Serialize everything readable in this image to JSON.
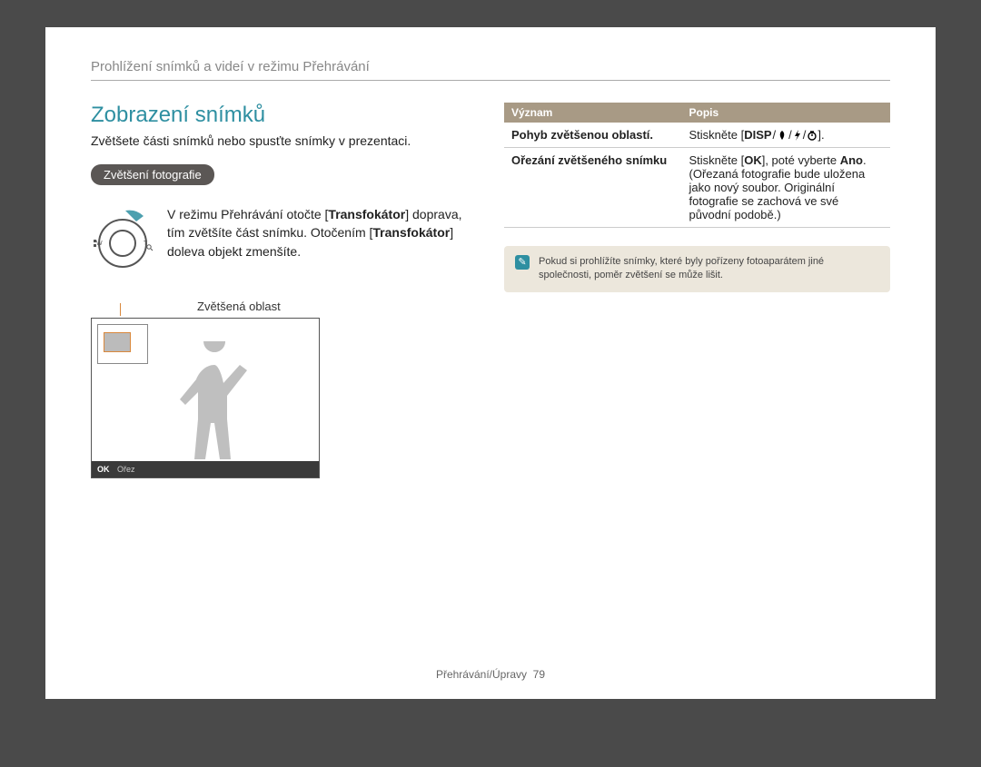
{
  "header": "Prohlížení snímků a videí v režimu Přehrávání",
  "section_title": "Zobrazení snímků",
  "intro": "Zvětšete části snímků nebo spusťte snímky v prezentaci.",
  "badge": "Zvětšení fotografie",
  "dial_before": "V režimu Přehrávání otočte [",
  "dial_word1": "Transfokátor",
  "dial_mid1": "] doprava, tím zvětšíte část snímku. Otočením [",
  "dial_word2": "Transfokátor",
  "dial_after": "] doleva objekt zmenšíte.",
  "zoom_label": "Zvětšená oblast",
  "screen_ok": "OK",
  "screen_crop": "Ořez",
  "table": {
    "head_col1": "Význam",
    "head_col2": "Popis",
    "row1_term": "Pohyb zvětšenou oblastí.",
    "row1_desc_before": "Stiskněte [",
    "row1_disp": "DISP",
    "row1_desc_after": "].",
    "row2_term": "Ořezání zvětšeného snímku",
    "row2_desc_before": "Stiskněte [",
    "row2_ok": "OK",
    "row2_desc_mid": "], poté vyberte ",
    "row2_ano": "Ano",
    "row2_desc_after": ". (Ořezaná fotografie bude uložena jako nový soubor. Originální fotografie se zachová ve své původní podobě.)"
  },
  "note": "Pokud si prohlížíte snímky, které byly pořízeny fotoaparátem jiné společnosti, poměr zvětšení se může lišit.",
  "footer_label": "Přehrávání/Úpravy",
  "footer_page": "79"
}
